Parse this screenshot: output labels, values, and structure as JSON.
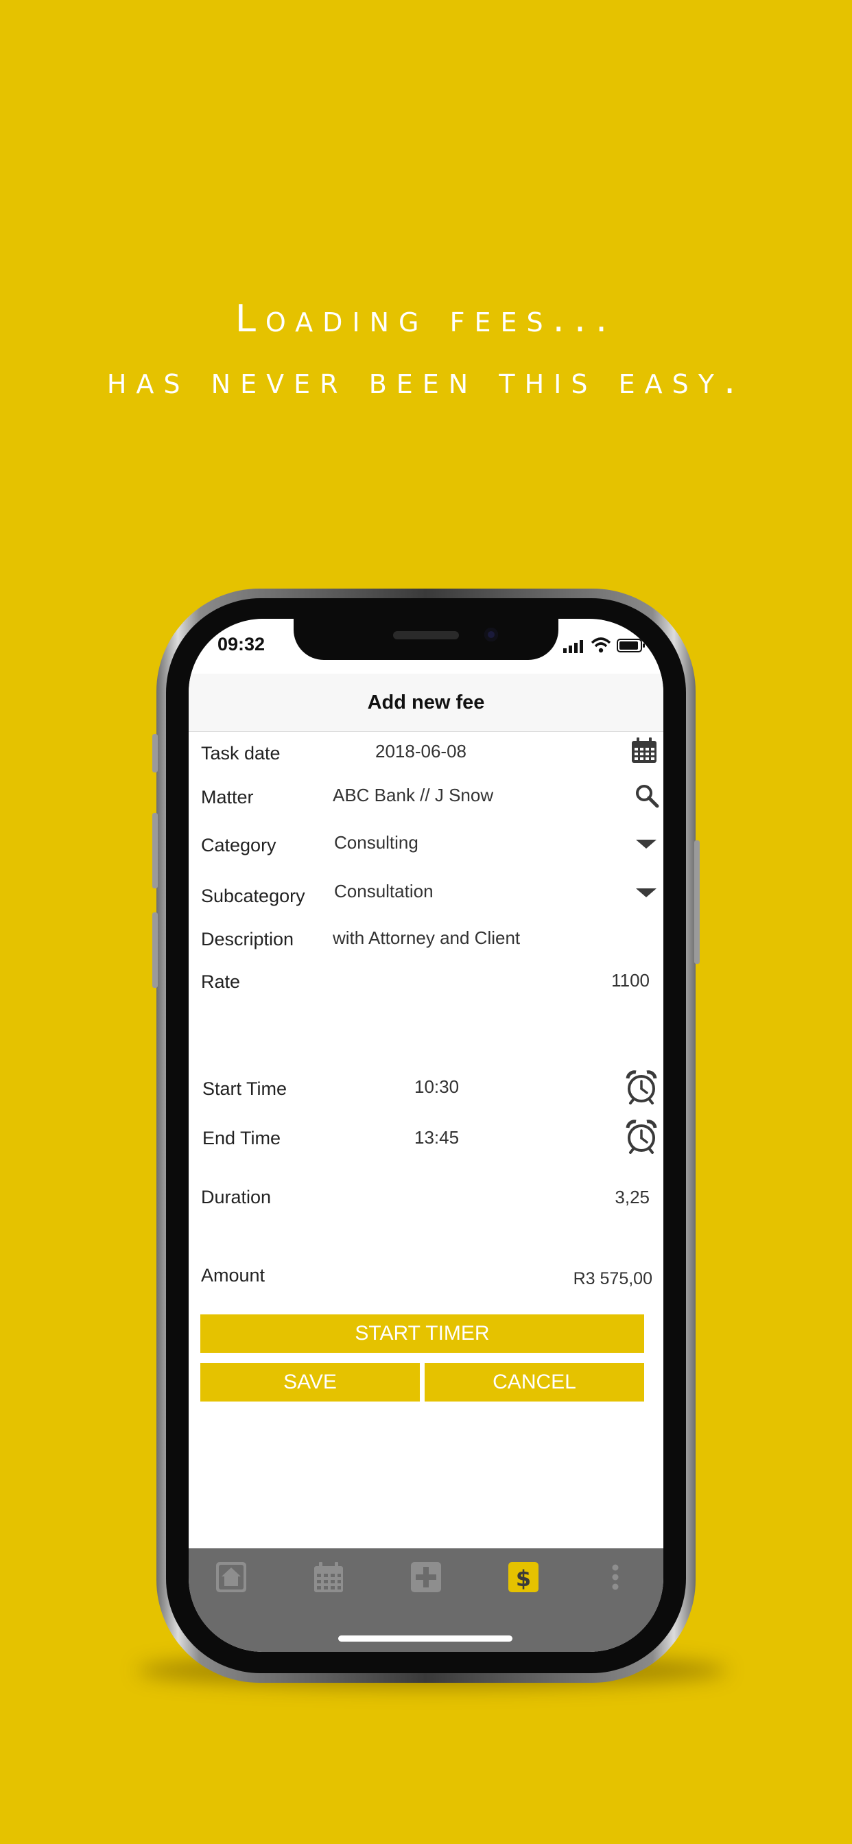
{
  "headline": {
    "line1": "Loading fees...",
    "line2": "has never been this easy."
  },
  "status_bar": {
    "time": "09:32"
  },
  "nav": {
    "title": "Add new fee"
  },
  "form": {
    "task_date": {
      "label": "Task date",
      "value": "2018-06-08"
    },
    "matter": {
      "label": "Matter",
      "value": "ABC Bank // J Snow"
    },
    "category": {
      "label": "Category",
      "value": "Consulting"
    },
    "subcategory": {
      "label": "Subcategory",
      "value": "Consultation"
    },
    "description": {
      "label": "Description",
      "value": "with Attorney and Client"
    },
    "rate": {
      "label": "Rate",
      "value": "1100"
    },
    "start_time": {
      "label": "Start Time",
      "value": "10:30"
    },
    "end_time": {
      "label": "End Time",
      "value": "13:45"
    },
    "duration": {
      "label": "Duration",
      "value": "3,25"
    },
    "amount": {
      "label": "Amount",
      "value": "R3 575,00"
    }
  },
  "buttons": {
    "start_timer": "START TIMER",
    "save": "SAVE",
    "cancel": "CANCEL"
  },
  "tabbar": {
    "items": [
      {
        "icon": "home-icon",
        "active": false
      },
      {
        "icon": "calendar-icon",
        "active": false
      },
      {
        "icon": "plus-icon",
        "active": false
      },
      {
        "icon": "dollar-icon",
        "active": true
      },
      {
        "icon": "more-vertical-icon",
        "active": false
      }
    ]
  },
  "colors": {
    "accent": "#e5c200",
    "tabbar_bg": "#6b6b6b",
    "tab_inactive": "#8e8e8e"
  }
}
